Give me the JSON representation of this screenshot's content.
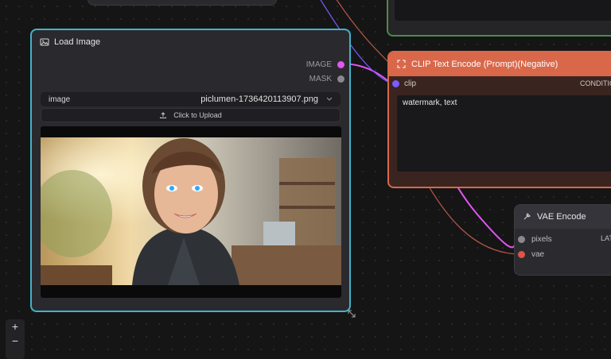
{
  "nodes": {
    "load_image": {
      "title": "Load Image",
      "outputs": [
        {
          "label": "IMAGE",
          "color": "#e056f0"
        },
        {
          "label": "MASK",
          "color": "#8a8a8e"
        }
      ],
      "widget_label": "image",
      "widget_value": "piclumen-1736420113907.png",
      "upload_label": "Click to Upload"
    },
    "clip_negative": {
      "title": "CLIP Text Encode (Prompt)(Negative)",
      "input_label": "clip",
      "output_label": "CONDITIO",
      "text": "watermark, text"
    },
    "vae_encode": {
      "title": "VAE Encode",
      "inputs": [
        {
          "label": "pixels",
          "color": "#8a8a8e"
        },
        {
          "label": "vae",
          "color": "#e0524a"
        }
      ],
      "output_label": "LAT"
    }
  },
  "zoom_controls": {
    "zoom_in": "+",
    "zoom_out": "−"
  },
  "colors": {
    "accent_selected": "#42b3c9",
    "negative_header": "#d9684a",
    "group_green": "#4d8a47",
    "image_wire": "#e056f0",
    "clip_wire": "#7b5cff"
  }
}
